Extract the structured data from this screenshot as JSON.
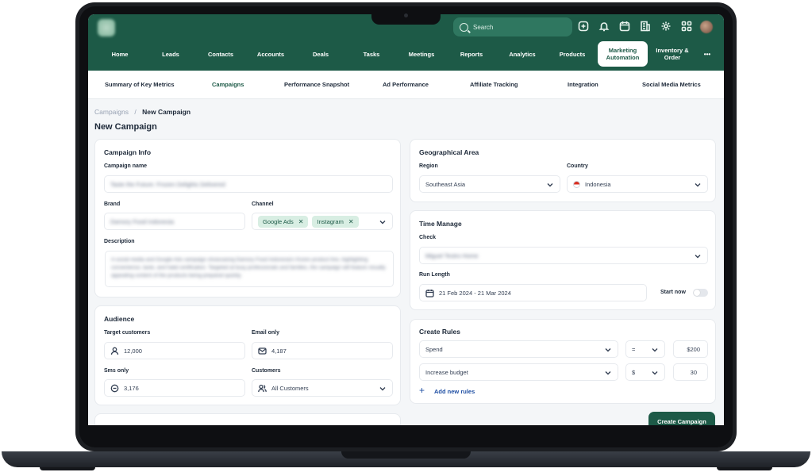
{
  "header": {
    "search_placeholder": "Search",
    "icons": [
      "plus-square-icon",
      "bell-icon",
      "calendar-icon",
      "building-icon",
      "gear-icon",
      "grid-icon"
    ]
  },
  "nav": {
    "items": [
      "Home",
      "Leads",
      "Contacts",
      "Accounts",
      "Deals",
      "Tasks",
      "Meetings",
      "Reports",
      "Analytics",
      "Products"
    ],
    "active_line1": "Marketing",
    "active_line2": "Automation",
    "inventory_line1": "Inventory &",
    "inventory_line2": "Order",
    "more": "•••"
  },
  "subnav": {
    "items": [
      "Summary of Key Metrics",
      "Campaigns",
      "Performance Snapshot",
      "Ad Performance",
      "Affiliate Tracking",
      "Integration",
      "Social Media Metrics"
    ],
    "active_index": 1
  },
  "breadcrumb": {
    "parent": "Campaigns",
    "separator": "/",
    "current": "New Campaign"
  },
  "page_title": "New Campaign",
  "campaign_info": {
    "title": "Campaign Info",
    "name_label": "Campaign name",
    "name_value": "Taste the Future: Frozen Delights Delivered",
    "brand_label": "Brand",
    "brand_value": "Damory Food Indonesia",
    "channel_label": "Channel",
    "channels": [
      "Google Ads",
      "Instagram"
    ],
    "description_label": "Description",
    "description_value": "A social media and Google Ads campaign showcasing Damory Food Indonesia's frozen product line, highlighting convenience, taste, and halal certification. Targeted at busy professionals and families, the campaign will feature visually appealing content of the products being prepared quickly."
  },
  "audience": {
    "title": "Audience",
    "target_label": "Target customers",
    "target_value": "12,000",
    "email_label": "Email only",
    "email_value": "4,187",
    "sms_label": "Sms only",
    "sms_value": "3,176",
    "customers_label": "Customers",
    "customers_value": "All Customers"
  },
  "geo": {
    "title": "Geographical Area",
    "region_label": "Region",
    "region_value": "Southeast Asia",
    "country_label": "Country",
    "country_value": "Indonesia"
  },
  "time": {
    "title": "Time Manage",
    "check_label": "Check",
    "check_value": "Miguel Testro Home",
    "run_label": "Run Length",
    "run_value": "21 Feb 2024 - 21 Mar 2024",
    "start_now_label": "Start now"
  },
  "rules": {
    "title": "Create Rules",
    "rows": [
      {
        "metric": "Spend",
        "operator": "=",
        "value": "$200"
      },
      {
        "metric": "Increase budget",
        "operator": "$",
        "value": "30"
      }
    ],
    "add_label": "Add new rules"
  },
  "create_button": "Create Campaign",
  "colors": {
    "brand": "#1d5a47",
    "chip_bg": "#d8eee3",
    "link": "#1f4fa3"
  }
}
